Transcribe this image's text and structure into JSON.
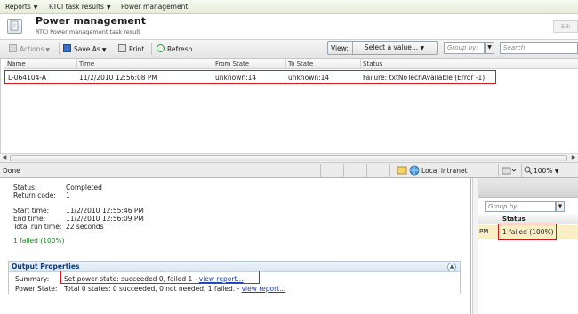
{
  "breadcrumb": {
    "items": [
      {
        "label": "Reports",
        "has_menu": true
      },
      {
        "label": "RTCI task results",
        "has_menu": true
      },
      {
        "label": "Power management",
        "has_menu": false
      }
    ]
  },
  "header": {
    "title": "Power management",
    "subtitle": "RTCI Power management task result",
    "edit_label": "Edi"
  },
  "toolbar": {
    "actions_label": "Actions",
    "save_as_label": "Save As",
    "print_label": "Print",
    "refresh_label": "Refresh",
    "view_label": "View:",
    "view_select_value": "Select a value...",
    "group_by_placeholder": "Group by:",
    "search_placeholder": "Search"
  },
  "grid": {
    "columns": [
      "Name",
      "Time",
      "From State",
      "To State",
      "Status"
    ],
    "rows": [
      {
        "name": "L-064104-A",
        "time": "11/2/2010 12:56:08 PM",
        "from_state": "unknown:14",
        "to_state": "unknown:14",
        "status": "Failure: txtNoTechAvailable (Error -1)"
      }
    ]
  },
  "statusbar": {
    "done": "Done",
    "zone": "Local intranet",
    "zoom": "100%"
  },
  "details": {
    "status_label": "Status:",
    "status_value": "Completed",
    "return_code_label": "Return code:",
    "return_code_value": "1",
    "start_time_label": "Start time:",
    "start_time_value": "11/2/2010 12:55:46 PM",
    "end_time_label": "End time:",
    "end_time_value": "11/2/2010 12:56:09 PM",
    "total_run_time_label": "Total run time:",
    "total_run_time_value": "22 seconds",
    "failed_summary": "1 failed (100%)"
  },
  "output_properties": {
    "title": "Output Properties",
    "summary_label": "Summary:",
    "summary_text": "Set power state: succeeded 0, failed 1 - ",
    "summary_link": "view report...",
    "power_state_label": "Power State:",
    "power_state_text": "Total 0 states: 0 succeeded, 0 not needed, 1 failed. - ",
    "power_state_link": "view report..."
  },
  "right_pane": {
    "group_by_placeholder": "Group by",
    "status_header": "Status",
    "row_prefix": "PM",
    "row_status": "1 failed (100%)"
  },
  "colors": {
    "highlight_border": "#d41b1b",
    "success_text": "#1b8a21",
    "link": "#1a3fb0",
    "section_title": "#0a3a7a",
    "selected_row": "#faeec5"
  }
}
